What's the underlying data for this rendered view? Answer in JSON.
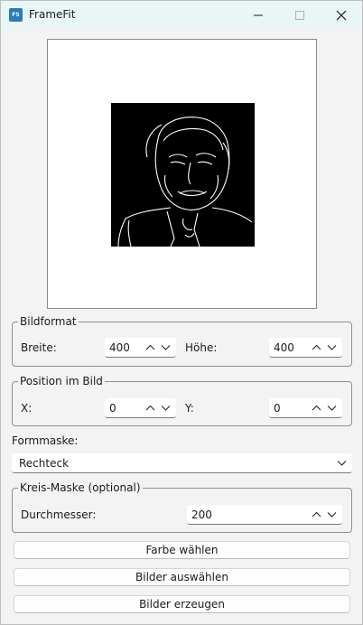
{
  "window": {
    "title": "FrameFit",
    "icon_text": "FS"
  },
  "format": {
    "legend": "Bildformat",
    "width_label": "Breite:",
    "width_value": "400",
    "height_label": "Höhe:",
    "height_value": "400"
  },
  "position": {
    "legend": "Position im Bild",
    "x_label": "X:",
    "x_value": "0",
    "y_label": "Y:",
    "y_value": "0"
  },
  "mask": {
    "label": "Formmaske:",
    "selected": "Rechteck"
  },
  "circle": {
    "legend": "Kreis-Maske (optional)",
    "diameter_label": "Durchmesser:",
    "diameter_value": "200"
  },
  "buttons": {
    "color": "Farbe wählen",
    "select": "Bilder auswählen",
    "generate": "Bilder erzeugen"
  }
}
